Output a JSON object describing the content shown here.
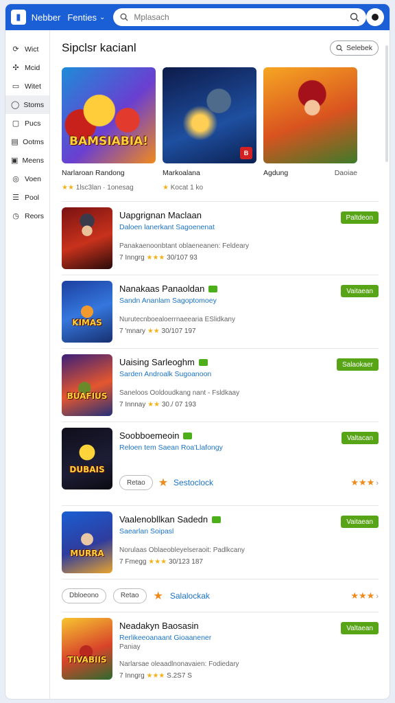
{
  "header": {
    "brand": "Nebber",
    "tab_label": "Fenties",
    "search_placeholder": "Mplasach"
  },
  "sidebar": {
    "items": [
      {
        "label": "Wict",
        "icon": "circle-arrow-icon"
      },
      {
        "label": "Mcid",
        "icon": "puzzle-icon"
      },
      {
        "label": "Witet",
        "icon": "monitor-icon"
      },
      {
        "label": "Stoms",
        "icon": "chat-icon",
        "active": true
      },
      {
        "label": "Pucs",
        "icon": "calendar-icon"
      },
      {
        "label": "Ootms",
        "icon": "document-icon"
      },
      {
        "label": "Meens",
        "icon": "screen-icon"
      },
      {
        "label": "Voen",
        "icon": "globe-icon"
      },
      {
        "label": "Pool",
        "icon": "list-icon"
      },
      {
        "label": "Reors",
        "icon": "clock-icon"
      }
    ]
  },
  "section": {
    "title": "Sipclsr kacianl",
    "select_label": "Selebek"
  },
  "featured": [
    {
      "art_text": "BAMSIABIA!",
      "title": "Narlaroan Randong",
      "sub": "",
      "rating_text": "1lsc3lan · 1onesag",
      "stars": "★★",
      "art": "art1"
    },
    {
      "art_text": "",
      "title": "Markoalana",
      "sub": "",
      "rating_text": "Kocat 1 ko",
      "stars": "★",
      "art": "art2"
    },
    {
      "art_text": "",
      "title": "Agdung",
      "sub": "Daoiae",
      "rating_text": "",
      "stars": "",
      "art": "art3"
    }
  ],
  "list": [
    {
      "title": "Uapgrignan Maclaan",
      "sub": "Daloen lanerkant Sagoenenat",
      "desc": "Panakaenoonbtant oblaeneanen: Feldeary",
      "meta_left": "7 Inngrg",
      "stars": "★★★",
      "meta_right": "30/107 93",
      "button": "Paltdeon",
      "badge": false,
      "art": "art4",
      "art_text": ""
    },
    {
      "title": "Nanakaas Panaoldan",
      "sub": "Sandn Ananlam Sagoptomoey",
      "desc": "Nurutecnboealoerrnaeearia ESlidkany",
      "meta_left": "7 'mnary",
      "stars": "★★",
      "meta_right": "30/107 197",
      "button": "Vaitaean",
      "badge": true,
      "art": "art5",
      "art_text": "KIMAS"
    },
    {
      "title": "Uaising Sarleoghm",
      "sub": "Sarden Androalk Sugoanoon",
      "desc": "Saneloos Ooldoudkang nant - Fsldkaay",
      "meta_left": "7 Innnay",
      "stars": "★★",
      "meta_right": "30./ 07 193",
      "button": "Salaokaer",
      "badge": true,
      "art": "art6",
      "art_text": "BUAFIUS"
    },
    {
      "title": "Soobboemeoin",
      "sub": "Reloen tem Saean Roa'Llafongy",
      "desc": "",
      "meta_left": "",
      "stars": "",
      "meta_right": "",
      "button": "Valtacan",
      "badge": true,
      "art": "art7",
      "art_text": "DUBAIS",
      "actions": {
        "pill": "Retao",
        "link": "Sestoclock",
        "stars": "★★★"
      }
    },
    {
      "title": "Vaalenobllkan Sadedn",
      "sub": "Saearlan Soipasl",
      "desc": "Norulaas Oblaeobleyelseraoit: Padlkcany",
      "meta_left": "7 Fmegg",
      "stars": "★★★",
      "meta_right": "30/123 187",
      "button": "Vaitaean",
      "badge": true,
      "art": "art8",
      "art_text": "MURRA"
    }
  ],
  "action_bar": {
    "pill1": "Dbloeono",
    "pill2": "Retao",
    "link": "Salalockak",
    "stars": "★★★"
  },
  "last": {
    "title": "Neadakyn Baosasin",
    "sub": "Rerlikeeoanaant Gioaanener",
    "sub2": "Paniay",
    "desc": "Narlarsae oleaadlnonavaien: Fodiedary",
    "meta_left": "7 Inngrg",
    "stars": "★★★",
    "meta_right": "S.2S7 S",
    "button": "Valtaean",
    "art": "art9",
    "art_text": "TIVABIIS"
  }
}
